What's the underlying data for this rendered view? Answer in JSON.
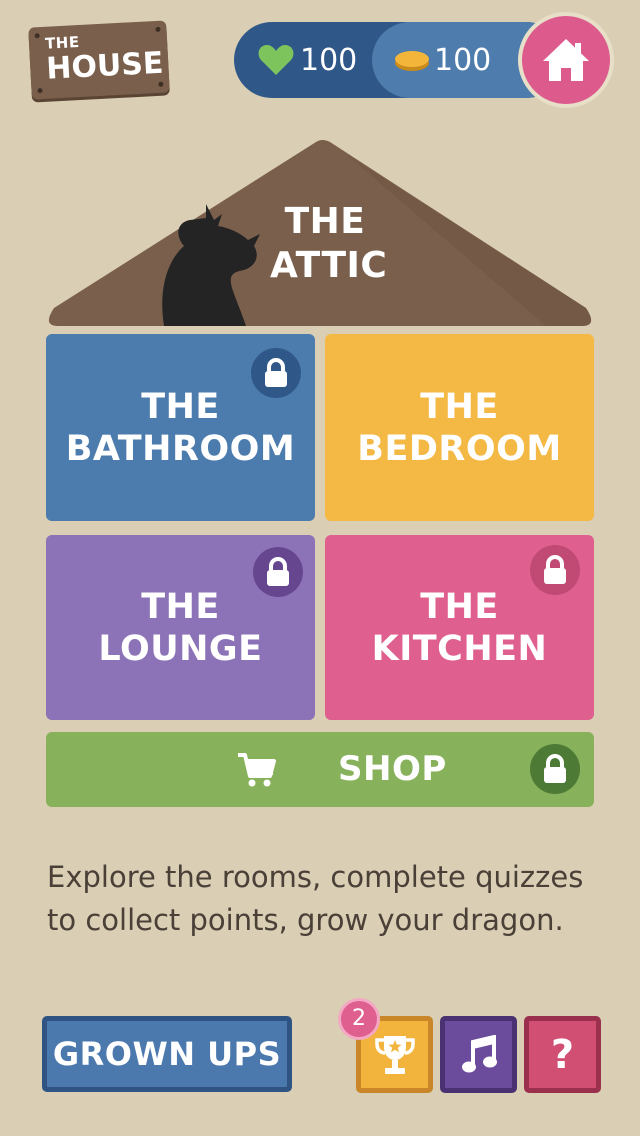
{
  "logo": {
    "line1": "THE",
    "line2": "HOUSE"
  },
  "stats": {
    "lives": "100",
    "coins": "100",
    "lives_icon": "heart-icon",
    "coins_icon": "coin-icon"
  },
  "home": {
    "icon": "house-icon"
  },
  "attic": {
    "line1": "THE",
    "line2": "ATTIC"
  },
  "rooms": [
    {
      "line1": "THE",
      "line2": "BATHROOM",
      "locked": true,
      "color": "#4c7bad"
    },
    {
      "line1": "THE",
      "line2": "BEDROOM",
      "locked": false,
      "color": "#f3b944"
    },
    {
      "line1": "THE",
      "line2": "LOUNGE",
      "locked": true,
      "color": "#8c72b6"
    },
    {
      "line1": "THE",
      "line2": "KITCHEN",
      "locked": true,
      "color": "#df5f8e"
    }
  ],
  "shop": {
    "label": "SHOP",
    "locked": true,
    "icon": "cart-icon"
  },
  "description": "Explore the rooms, complete quizzes to collect points, grow your dragon.",
  "footer": {
    "grown_ups": "GROWN UPS",
    "trophy_badge": "2",
    "help_label": "?",
    "trophy_icon": "trophy-icon",
    "music_icon": "music-note-icon"
  }
}
